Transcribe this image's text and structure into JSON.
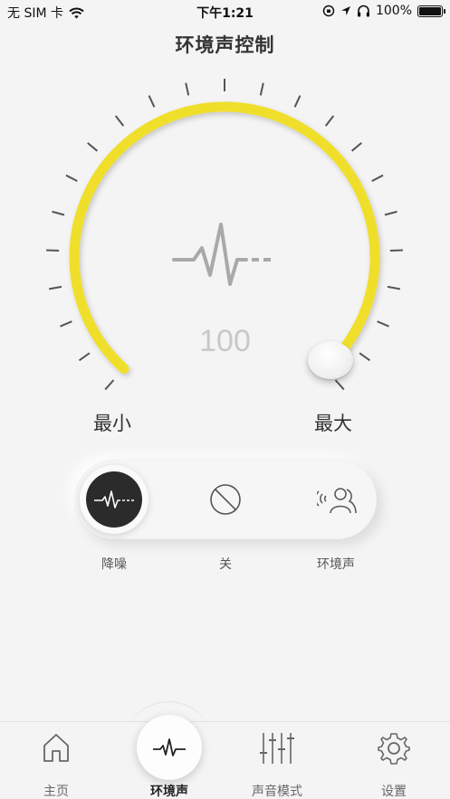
{
  "status_bar": {
    "carrier": "无 SIM 卡",
    "time": "下午1:21",
    "battery_percent": "100%",
    "battery_level": 1.0
  },
  "page": {
    "title": "环境声控制"
  },
  "dial": {
    "value": "100",
    "min_label": "最小",
    "max_label": "最大",
    "level_fraction": 1.0,
    "accent_color": "#f0df2a",
    "center_icon": "waveform-icon"
  },
  "modes": {
    "items": [
      {
        "id": "noise-cancel",
        "label": "降噪",
        "icon": "waveform-icon",
        "active": true
      },
      {
        "id": "off",
        "label": "关",
        "icon": "off-circle-icon",
        "active": false
      },
      {
        "id": "ambient",
        "label": "环境声",
        "icon": "ambient-person-icon",
        "active": false
      }
    ]
  },
  "tabs": {
    "items": [
      {
        "label": "主页",
        "icon": "home-icon",
        "active": false
      },
      {
        "label": "环境声",
        "icon": "waveform-icon",
        "active": true
      },
      {
        "label": "声音模式",
        "icon": "equalizer-icon",
        "active": false
      },
      {
        "label": "设置",
        "icon": "gear-icon",
        "active": false
      }
    ]
  }
}
